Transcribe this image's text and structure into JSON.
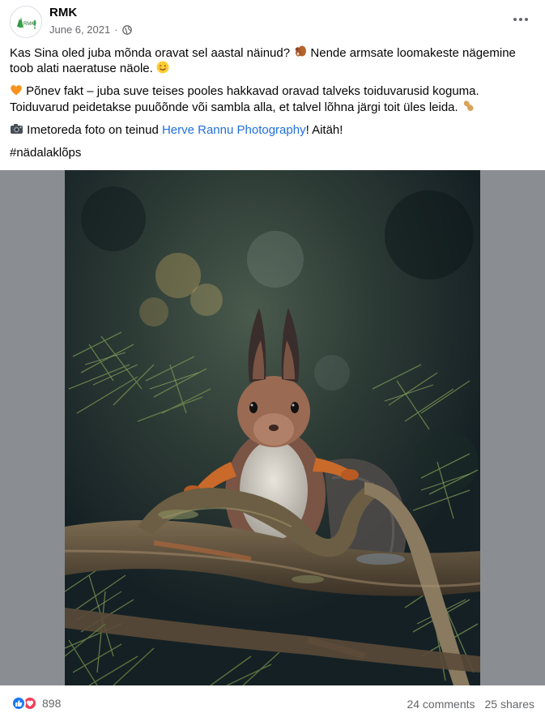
{
  "post": {
    "page_name": "RMK",
    "date": "June 6, 2021",
    "separator": "·",
    "avatar_text": "RMK",
    "paragraphs": {
      "p1_a": "Kas Sina oled juba mõnda oravat sel aastal näinud? ",
      "p1_b": " Nende armsate loomakeste nägemine toob alati naeratuse näole. ",
      "p2_a": " Põnev fakt – juba suve teises pooles hakkavad oravad talveks toiduvarusid koguma. Toiduvarud peidetakse puuõõnde või sambla alla, et talvel lõhna järgi toit üles leida. ",
      "p3_a": " Imetoreda foto on teinud ",
      "p3_link": "Herve Rannu Photography",
      "p3_b": "! Aitäh!",
      "p4": "#nädalaklõps"
    },
    "icons": {
      "p1_emoji_1": "squirrel-emoji-icon",
      "p1_emoji_2": "smiling-face-emoji-icon",
      "p2_emoji_1": "orange-heart-emoji-icon",
      "p2_emoji_2": "peanut-emoji-icon",
      "p3_emoji_1": "camera-emoji-icon"
    },
    "link_color": "#216fdb"
  },
  "footer": {
    "reaction_count": "898",
    "comments": "24 comments",
    "shares": "25 shares",
    "like_color": "#1877f2",
    "love_color": "#f33e58"
  }
}
